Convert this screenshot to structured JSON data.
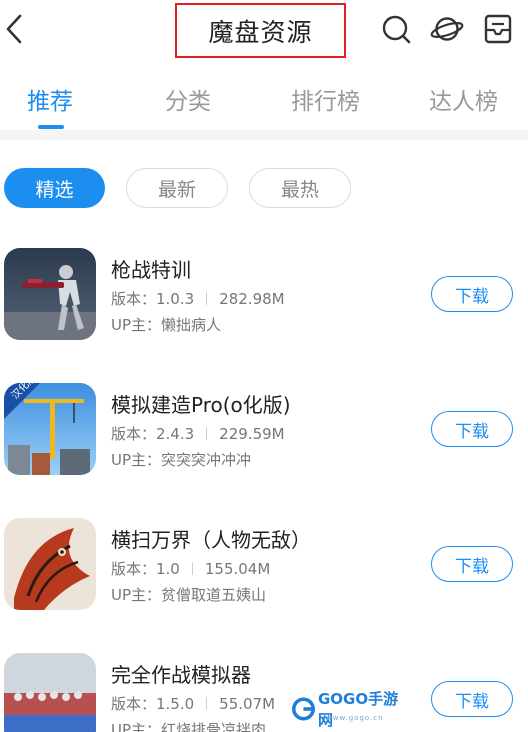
{
  "header": {
    "title": "魔盘资源",
    "icons": [
      "back-icon",
      "search-icon",
      "planet-icon",
      "download-manager-icon"
    ]
  },
  "tabs": [
    {
      "label": "推荐",
      "active": true
    },
    {
      "label": "分类",
      "active": false
    },
    {
      "label": "排行榜",
      "active": false
    },
    {
      "label": "达人榜",
      "active": false
    }
  ],
  "filters": [
    {
      "label": "精选",
      "active": true
    },
    {
      "label": "最新",
      "active": false
    },
    {
      "label": "最热",
      "active": false
    }
  ],
  "apps": [
    {
      "name": "枪战特训",
      "version": "版本：1.0.3",
      "size": "282.98M",
      "uploader": "UP主：懒拙病人",
      "download": "下载"
    },
    {
      "name": "模拟建造Pro(o化版)",
      "version": "版本：2.4.3",
      "size": "229.59M",
      "uploader": "UP主：突突突冲冲冲",
      "download": "下载"
    },
    {
      "name": "横扫万界（人物无敌）",
      "version": "版本：1.0",
      "size": "155.04M",
      "uploader": "UP主：贫僧取道五姨山",
      "download": "下载"
    },
    {
      "name": "完全作战模拟器",
      "version": "版本：1.5.0",
      "size": "55.07M",
      "uploader": "UP主：红烧排骨凉拌肉",
      "download": "下载"
    }
  ],
  "icon_labels": {
    "app2_badge": "汉化版"
  },
  "watermark": {
    "brand": "GOGO手游网",
    "domain": "www.gogo.cn"
  },
  "colors": {
    "accent": "#1c8ef0",
    "highlight_box": "#e02020"
  }
}
